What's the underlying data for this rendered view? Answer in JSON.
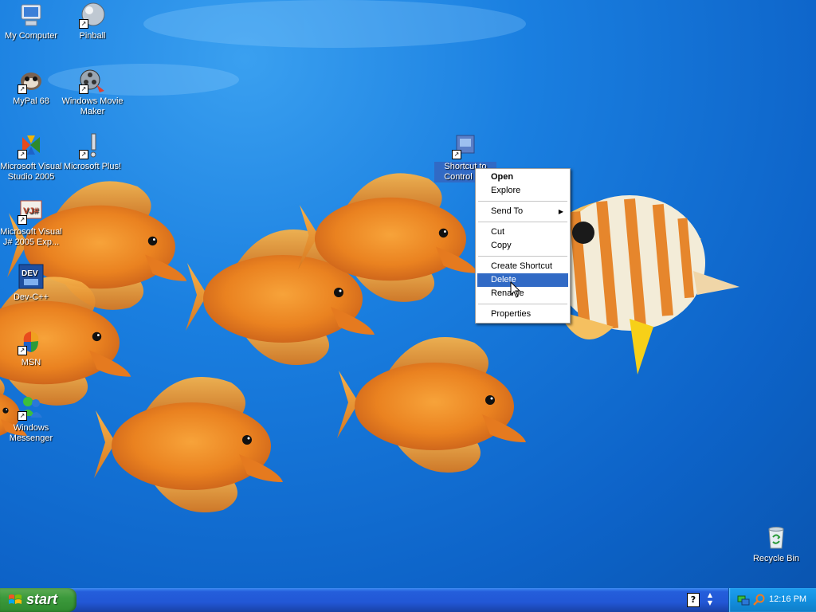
{
  "desktop": {
    "icons": [
      {
        "label": "My Computer",
        "icon": "my-computer-icon"
      },
      {
        "label": "Pinball",
        "icon": "pinball-icon"
      },
      {
        "label": "MyPal 68",
        "icon": "mypal-icon"
      },
      {
        "label": "Windows Movie Maker",
        "icon": "movie-maker-icon"
      },
      {
        "label": "Microsoft Visual Studio 2005",
        "icon": "visual-studio-icon"
      },
      {
        "label": "Microsoft Plus!",
        "icon": "microsoft-plus-icon"
      },
      {
        "label": "Microsoft Visual J# 2005 Exp...",
        "icon": "visual-jsharp-icon"
      },
      {
        "label": "Dev-C++",
        "icon": "dev-cpp-icon"
      },
      {
        "label": "MSN",
        "icon": "msn-icon"
      },
      {
        "label": "Windows Messenger",
        "icon": "windows-messenger-icon"
      },
      {
        "label": "Shortcut to Control P...",
        "icon": "control-panel-shortcut-icon"
      },
      {
        "label": "Recycle Bin",
        "icon": "recycle-bin-icon"
      }
    ]
  },
  "context_menu": {
    "items": [
      {
        "label": "Open",
        "bold": true
      },
      {
        "label": "Explore"
      },
      {
        "label": "Send To",
        "submenu": true
      },
      {
        "label": "Cut"
      },
      {
        "label": "Copy"
      },
      {
        "label": "Create Shortcut"
      },
      {
        "label": "Delete",
        "highlighted": true
      },
      {
        "label": "Rename"
      },
      {
        "label": "Properties"
      }
    ]
  },
  "taskbar": {
    "start_label": "start",
    "clock": "12:16 PM",
    "help_glyph": "?"
  },
  "colors": {
    "selection": "#316ac5",
    "taskbar": "#245edb",
    "start_green": "#3c9a3c",
    "tray": "#138fdf"
  }
}
